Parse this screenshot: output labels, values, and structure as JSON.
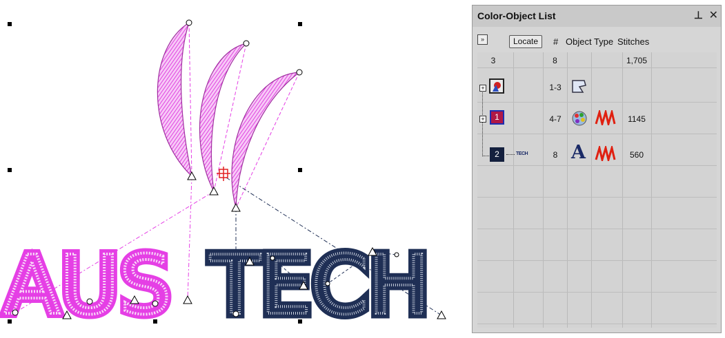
{
  "colors": {
    "pink": "#e53fe5",
    "navy": "#1f2f55",
    "panel_bg": "#d6d6d6",
    "swatch_red": "#b01846",
    "swatch_navy": "#14203e"
  },
  "canvas": {
    "text_left": "AUS",
    "text_right": "TECH"
  },
  "panel": {
    "title": "Color-Object List",
    "pin_icon": "pin-icon",
    "close_icon": "close-icon",
    "toolbar": {
      "expand_icon": "chevron-down-icon",
      "locate_label": "Locate",
      "headers": [
        "#",
        "Object Type",
        "Stitches"
      ]
    },
    "summary": {
      "count": "3",
      "objects": "8",
      "stitches": "1,705"
    },
    "rows": [
      {
        "objects": "1-3",
        "stitches": "",
        "type_icon": "appliqué-shape-icon"
      },
      {
        "color_number": "1",
        "objects": "4-7",
        "stitches": "1145",
        "type_icon": "palette-icon",
        "stitch_icon": "zigzag-stitch-icon"
      },
      {
        "color_number": "2",
        "label": "TECH",
        "objects": "8",
        "stitches": "560",
        "type_icon": "lettering-icon",
        "letter": "A",
        "stitch_icon": "zigzag-stitch-icon"
      }
    ]
  }
}
